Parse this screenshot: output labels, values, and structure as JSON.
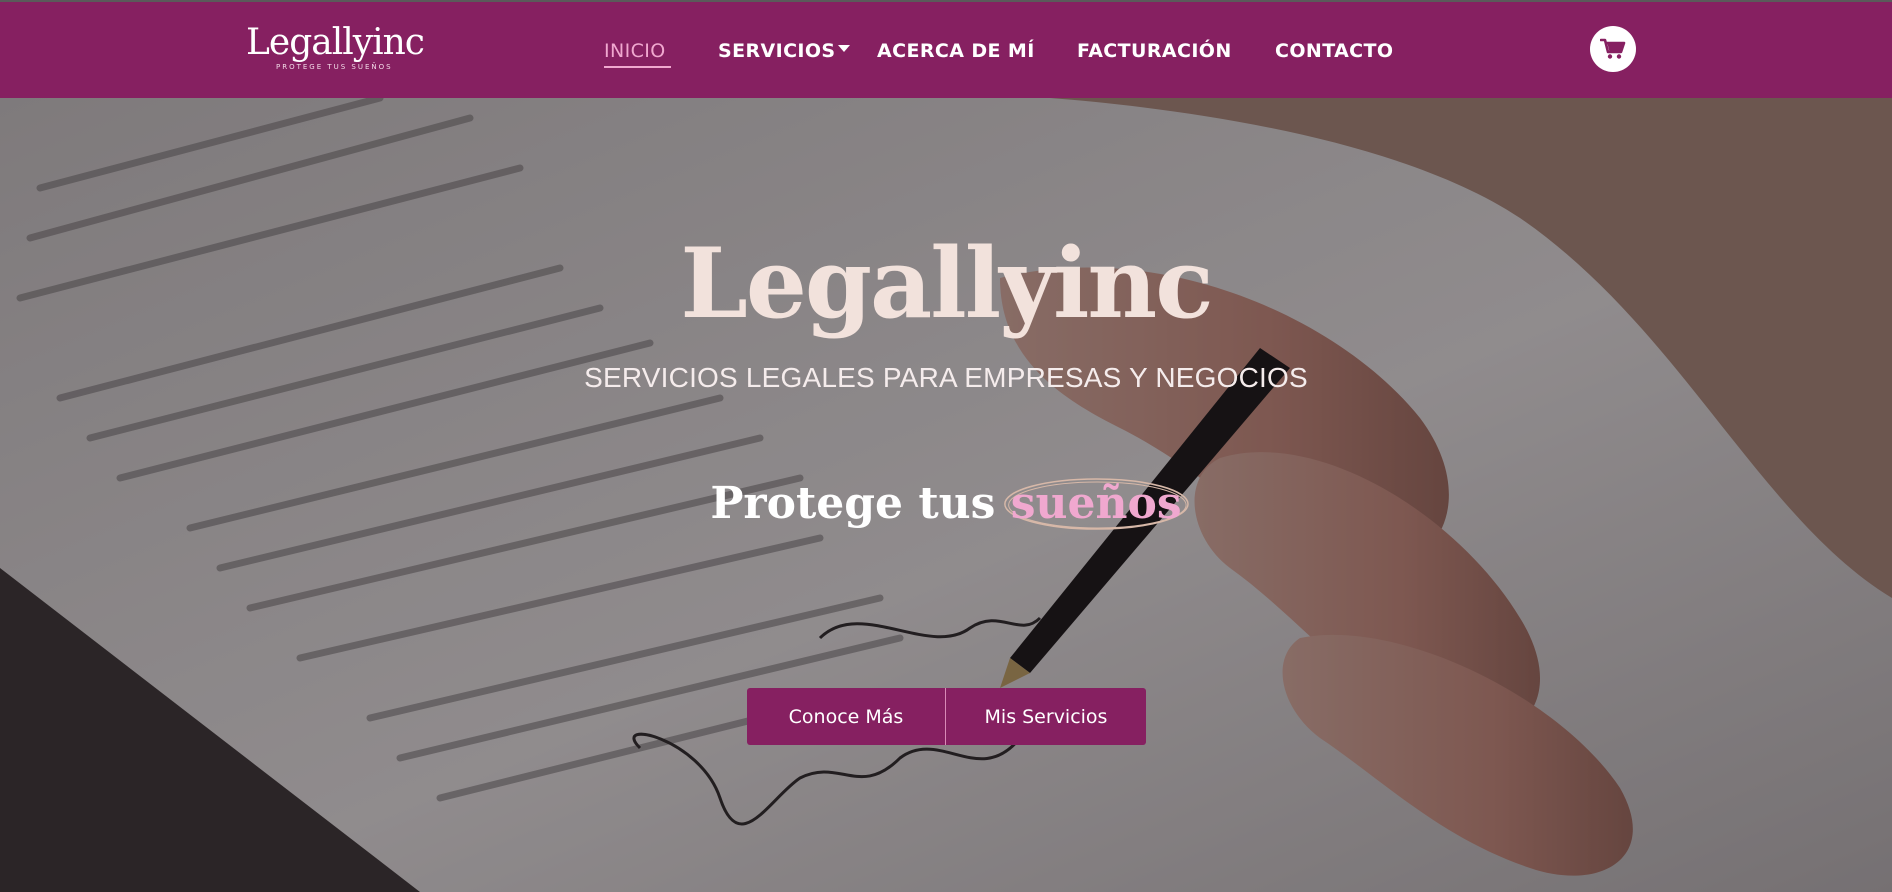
{
  "brand": {
    "logo_text": "Legallyinc",
    "logo_tagline": "PROTEGE TUS SUEÑOS",
    "primary_color": "#862061",
    "accent_color": "#f0a8cf"
  },
  "nav": {
    "items": [
      {
        "label": "INICIO",
        "active": true
      },
      {
        "label": "SERVICIOS",
        "has_dropdown": true
      },
      {
        "label": "ACERCA DE MÍ"
      },
      {
        "label": "FACTURACIÓN"
      },
      {
        "label": "CONTACTO"
      }
    ],
    "cart_icon": "shopping-cart-icon"
  },
  "hero": {
    "title": "Legallyinc",
    "subtitle": "SERVICIOS LEGALES PARA EMPRESAS Y NEGOCIOS",
    "tagline_prefix": "Protege tus",
    "tagline_highlight": "sueños",
    "buttons": [
      {
        "label": "Conoce Más"
      },
      {
        "label": "Mis Servicios"
      }
    ]
  }
}
